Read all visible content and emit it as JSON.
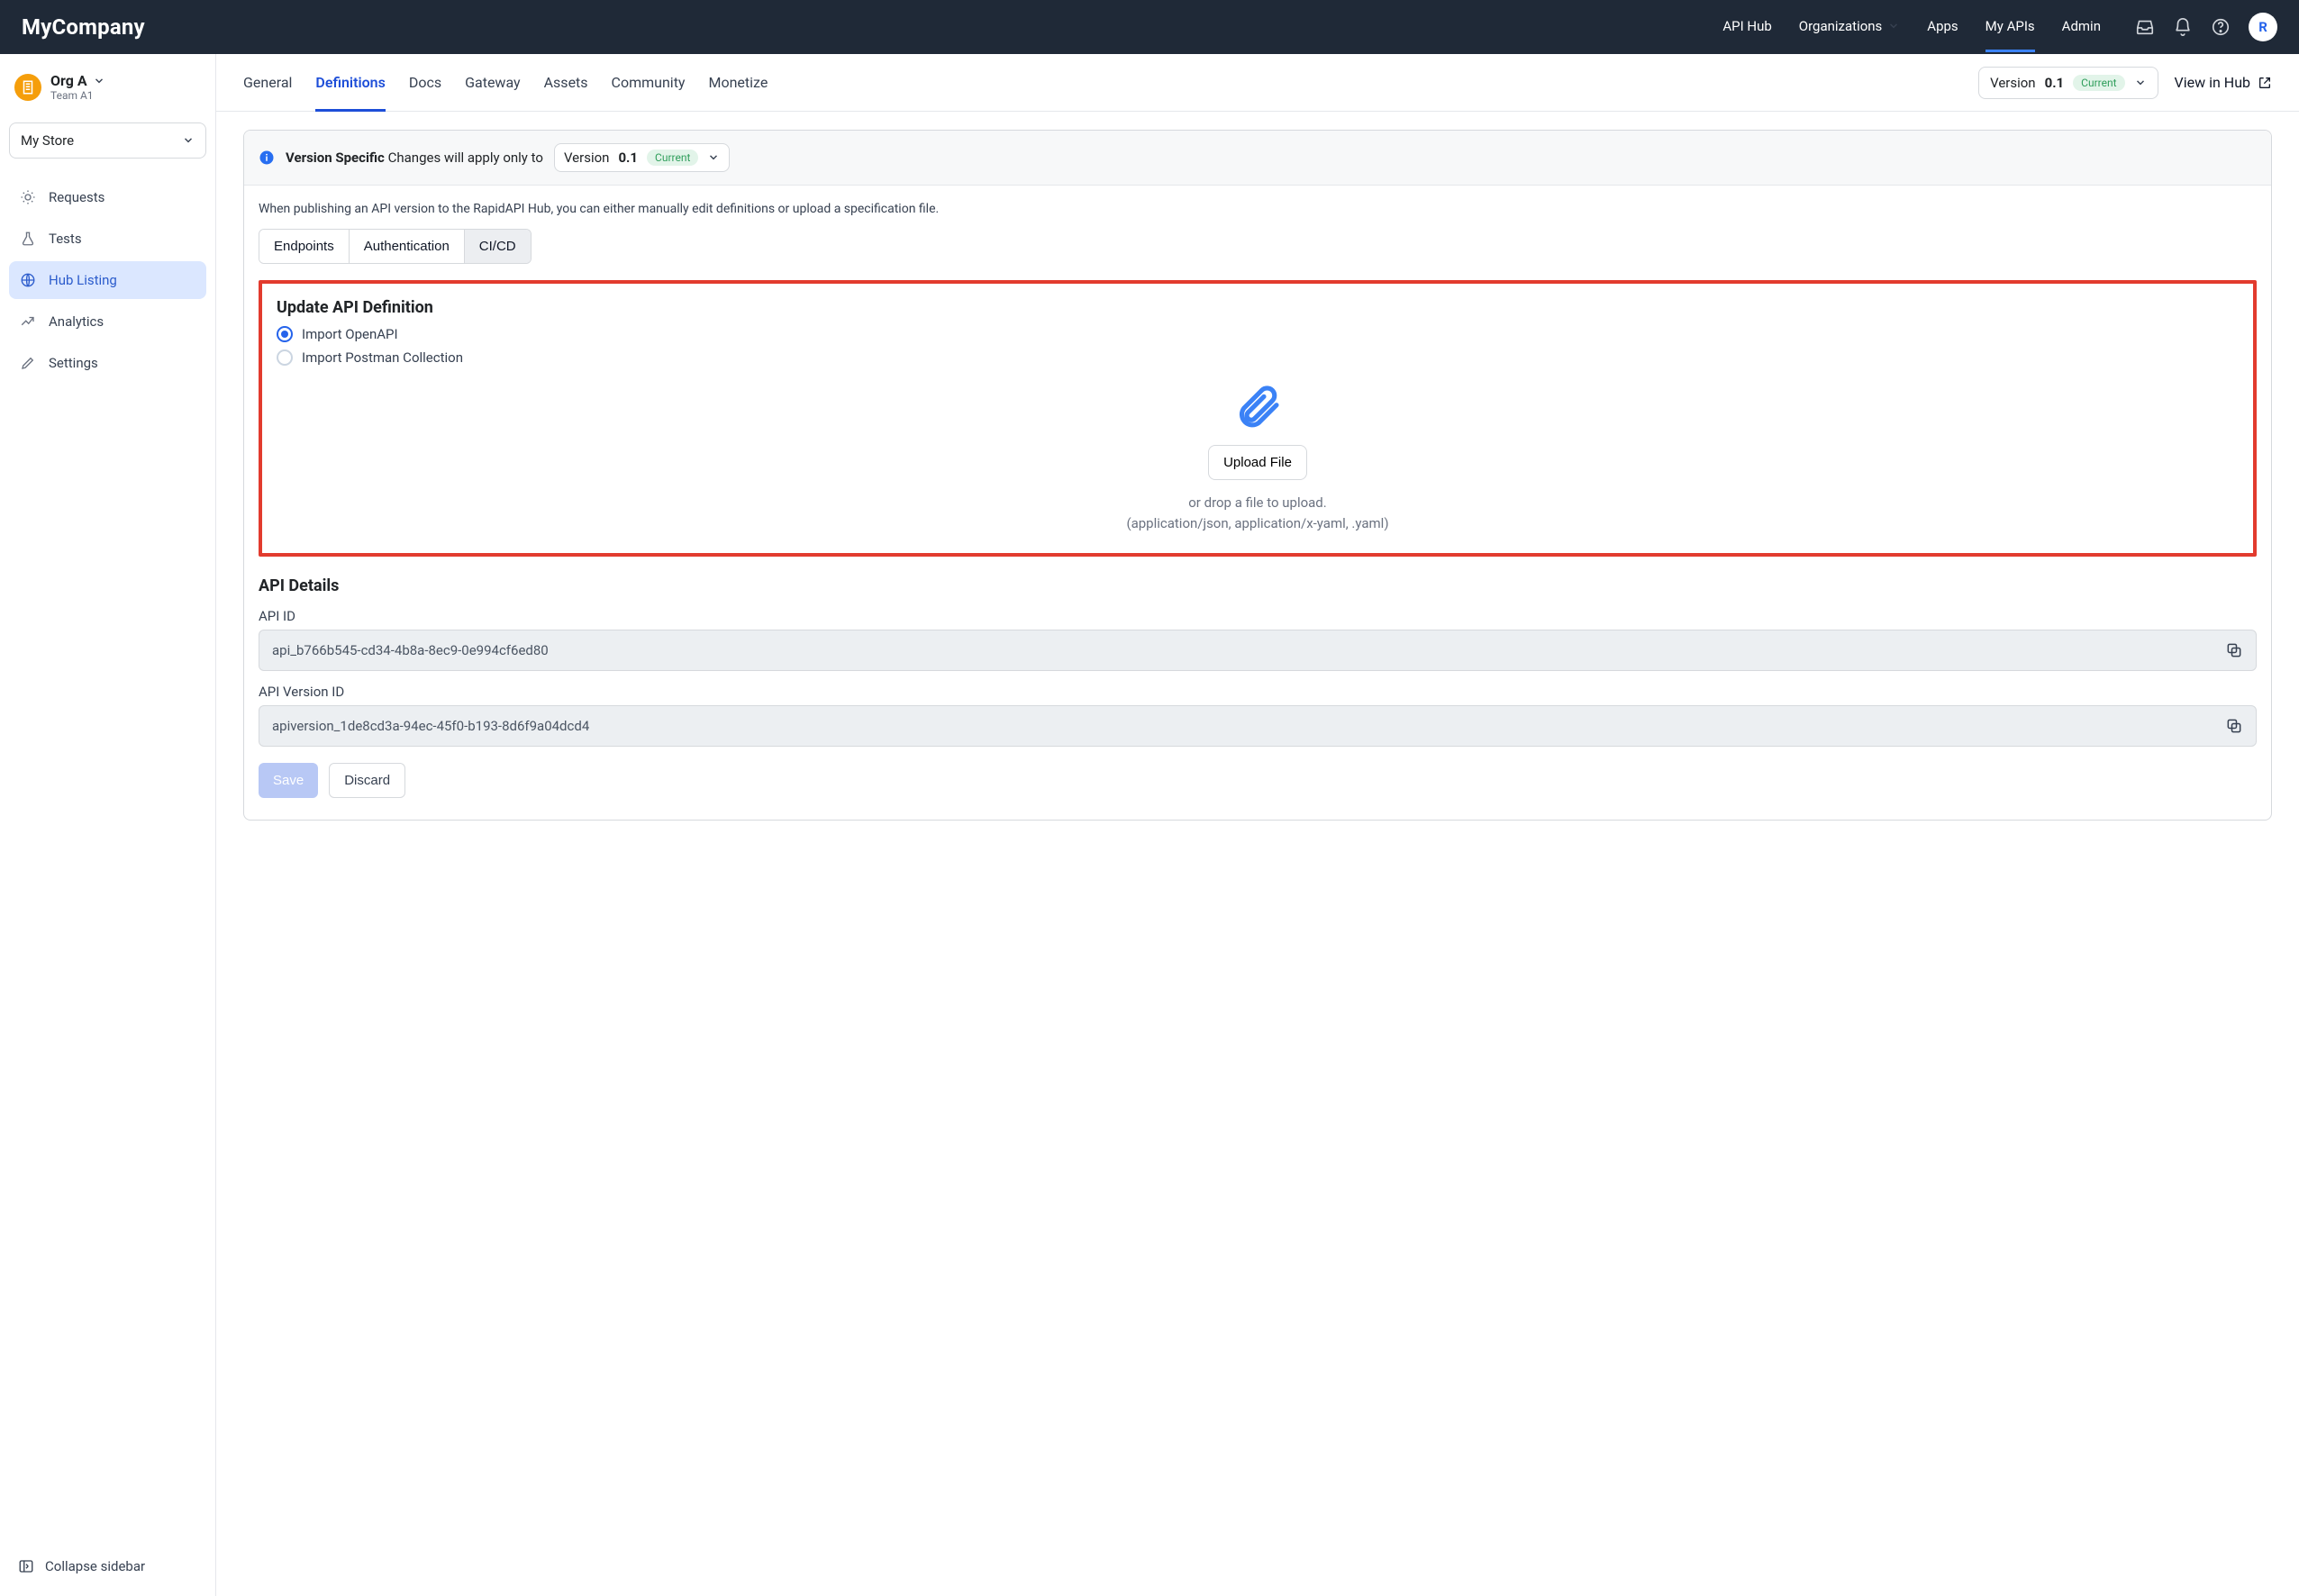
{
  "brand": "MyCompany",
  "topnav": {
    "api_hub": "API Hub",
    "organizations": "Organizations",
    "apps": "Apps",
    "my_apis": "My APIs",
    "admin": "Admin"
  },
  "avatar_initial": "R",
  "org": {
    "name": "Org A",
    "team": "Team A1"
  },
  "store_selector": "My Store",
  "sidebar": {
    "items": [
      {
        "label": "Requests"
      },
      {
        "label": "Tests"
      },
      {
        "label": "Hub Listing"
      },
      {
        "label": "Analytics"
      },
      {
        "label": "Settings"
      }
    ],
    "collapse": "Collapse sidebar"
  },
  "subtabs": {
    "general": "General",
    "definitions": "Definitions",
    "docs": "Docs",
    "gateway": "Gateway",
    "assets": "Assets",
    "community": "Community",
    "monetize": "Monetize"
  },
  "version": {
    "prefix": "Version ",
    "value": "0.1",
    "badge": "Current"
  },
  "view_in_hub": "View in Hub",
  "banner": {
    "strong": "Version Specific",
    "rest": "Changes will apply only to"
  },
  "helper_text": "When publishing an API version to the RapidAPI Hub, you can either manually edit definitions or upload a specification file.",
  "segtabs": {
    "endpoints": "Endpoints",
    "auth": "Authentication",
    "cicd": "CI/CD"
  },
  "update": {
    "title": "Update API Definition",
    "opt_openapi": "Import OpenAPI",
    "opt_postman": "Import Postman Collection",
    "upload_btn": "Upload File",
    "drop_line1": "or drop a file to upload.",
    "drop_line2": "(application/json, application/x-yaml, .yaml)"
  },
  "details": {
    "title": "API Details",
    "api_id_label": "API ID",
    "api_id_value": "api_b766b545-cd34-4b8a-8ec9-0e994cf6ed80",
    "api_version_id_label": "API Version ID",
    "api_version_id_value": "apiversion_1de8cd3a-94ec-45f0-b193-8d6f9a04dcd4"
  },
  "actions": {
    "save": "Save",
    "discard": "Discard"
  }
}
